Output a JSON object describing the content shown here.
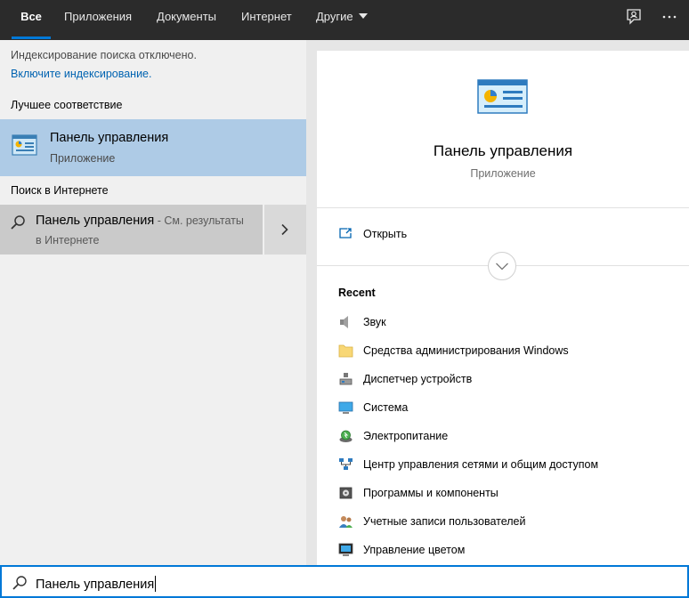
{
  "tabs": [
    {
      "label": "Все"
    },
    {
      "label": "Приложения"
    },
    {
      "label": "Документы"
    },
    {
      "label": "Интернет"
    },
    {
      "label": "Другие"
    }
  ],
  "left": {
    "indexing_off": "Индексирование поиска отключено.",
    "indexing_link": "Включите индексирование.",
    "best_match_heading": "Лучшее соответствие",
    "best_match": {
      "title": "Панель управления",
      "subtitle": "Приложение"
    },
    "web_heading": "Поиск в Интернете",
    "web_result": {
      "title": "Панель управления",
      "suffix": " - См. результаты",
      "subtitle": "в Интернете"
    }
  },
  "right": {
    "title": "Панель управления",
    "subtitle": "Приложение",
    "open_label": "Открыть",
    "recent_heading": "Recent",
    "recent": [
      {
        "label": "Звук",
        "icon": "speaker-icon"
      },
      {
        "label": "Средства администрирования Windows",
        "icon": "folder-icon"
      },
      {
        "label": "Диспетчер устройств",
        "icon": "device-manager-icon"
      },
      {
        "label": "Система",
        "icon": "monitor-icon"
      },
      {
        "label": "Электропитание",
        "icon": "power-options-icon"
      },
      {
        "label": "Центр управления сетями и общим доступом",
        "icon": "network-icon"
      },
      {
        "label": "Программы и компоненты",
        "icon": "programs-icon"
      },
      {
        "label": "Учетные записи пользователей",
        "icon": "users-icon"
      },
      {
        "label": "Управление цветом",
        "icon": "color-management-icon"
      }
    ]
  },
  "search": {
    "value": "Панель управления"
  },
  "colors": {
    "accent": "#0078d7",
    "selected": "#aecbe6",
    "topbar": "#2b2b2b"
  }
}
